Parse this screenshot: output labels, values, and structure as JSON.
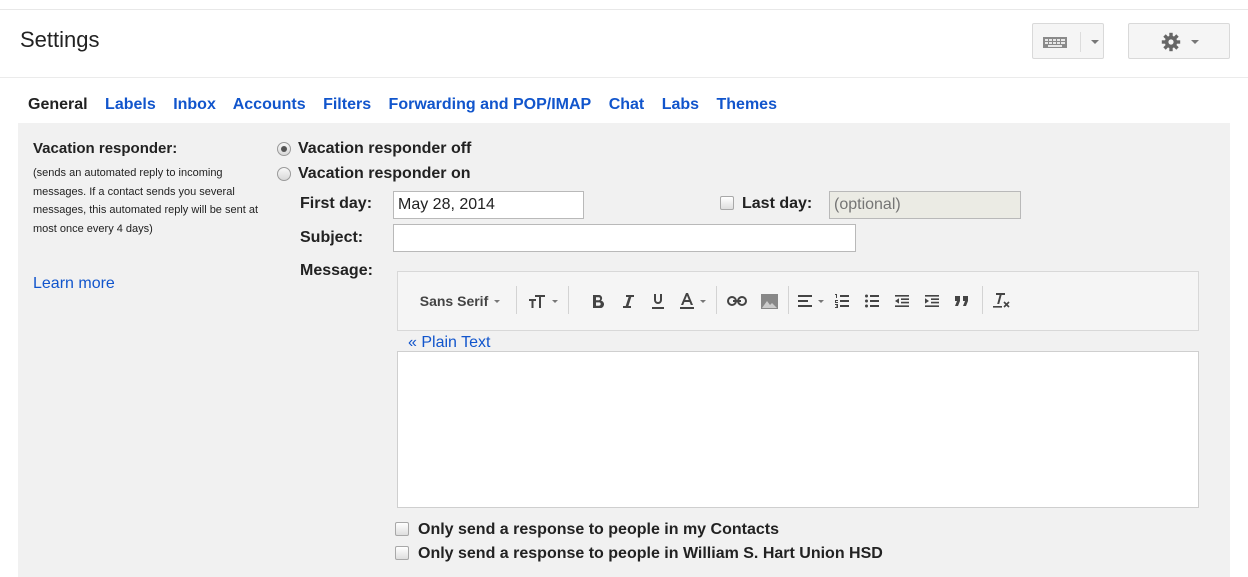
{
  "header": {
    "title": "Settings",
    "keyboard_icon": "keyboard-icon",
    "settings_icon": "gear-icon"
  },
  "tabs": [
    {
      "label": "General",
      "active": true
    },
    {
      "label": "Labels",
      "active": false
    },
    {
      "label": "Inbox",
      "active": false
    },
    {
      "label": "Accounts",
      "active": false
    },
    {
      "label": "Filters",
      "active": false
    },
    {
      "label": "Forwarding and POP/IMAP",
      "active": false
    },
    {
      "label": "Chat",
      "active": false
    },
    {
      "label": "Labs",
      "active": false
    },
    {
      "label": "Themes",
      "active": false
    }
  ],
  "vacation": {
    "title": "Vacation responder:",
    "description": "(sends an automated reply to incoming messages. If a contact sends you several messages, this automated reply will be sent at most once every 4 days)",
    "learn_more": "Learn more",
    "option_off": "Vacation responder off",
    "option_on": "Vacation responder on",
    "selected": "off",
    "first_day_label": "First day:",
    "first_day_value": "May 28, 2014",
    "last_day_label": "Last day:",
    "last_day_placeholder": "(optional)",
    "subject_label": "Subject:",
    "subject_value": "",
    "message_label": "Message:",
    "plain_text_link": "« Plain Text",
    "contacts_only_label": "Only send a response to people in my Contacts",
    "domain_only_label": "Only send a response to people in William S. Hart Union HSD"
  },
  "editor_toolbar": {
    "font_family": "Sans Serif",
    "icons": [
      "font-size-icon",
      "bold-icon",
      "italic-icon",
      "underline-icon",
      "text-color-icon",
      "link-icon",
      "image-icon",
      "align-icon",
      "numbered-list-icon",
      "bulleted-list-icon",
      "indent-less-icon",
      "indent-more-icon",
      "quote-icon",
      "remove-formatting-icon"
    ]
  },
  "colors": {
    "link": "#1155cc",
    "panel_bg": "#f1f1f1",
    "text": "#222222"
  }
}
